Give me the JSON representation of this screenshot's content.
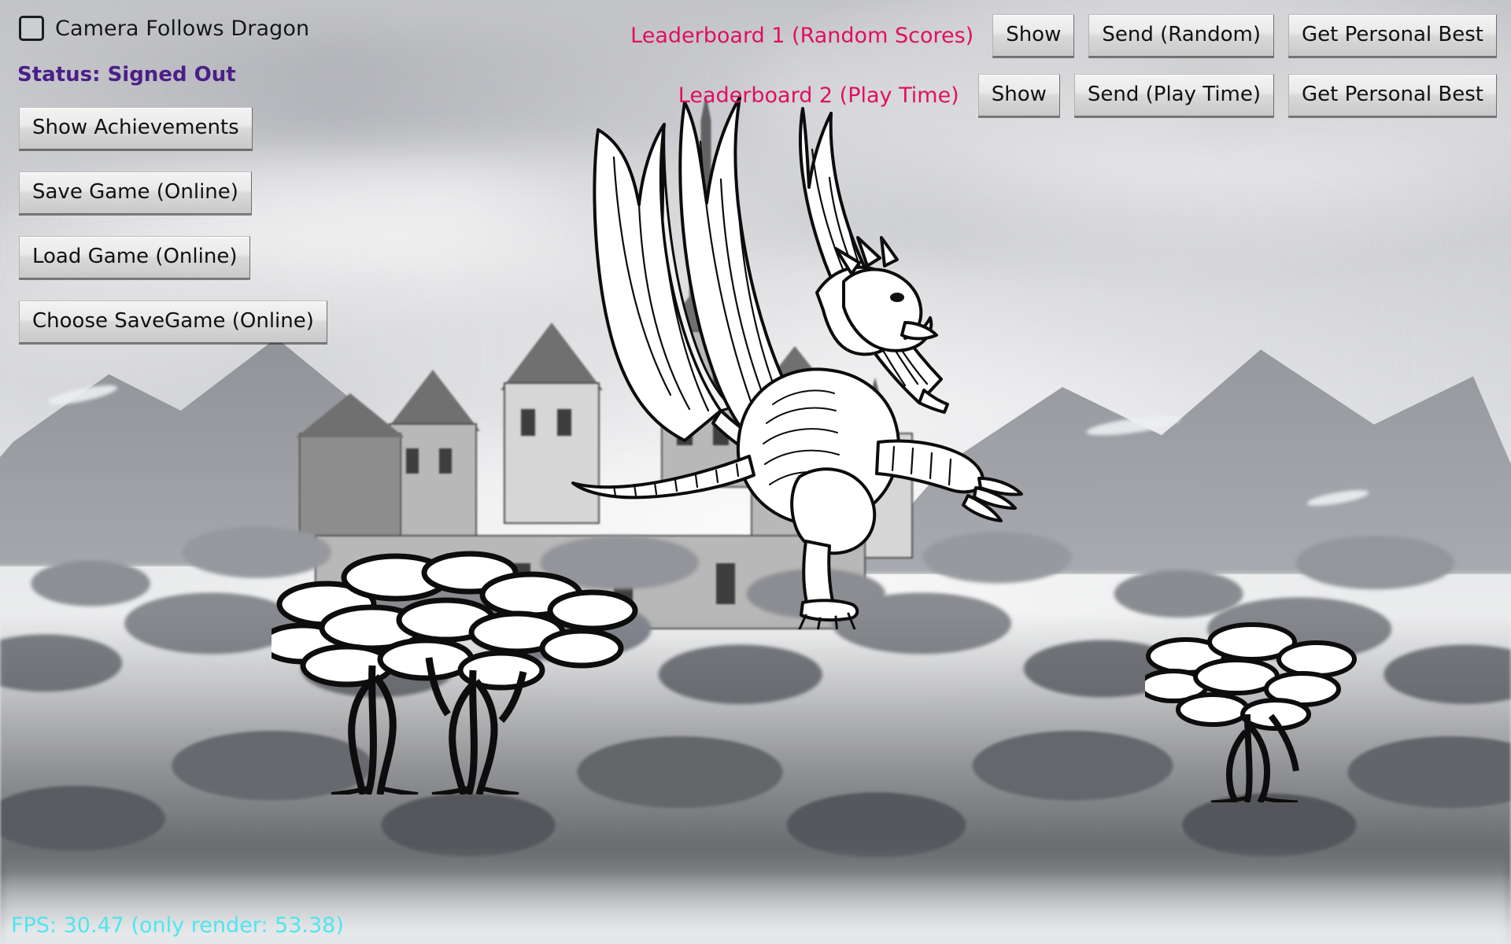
{
  "hud": {
    "camera_checkbox": {
      "label": "Camera Follows Dragon",
      "checked": false,
      "icon": "checkbox-unchecked-icon"
    },
    "status": {
      "text": "Status: Signed Out",
      "color": "#4a1f87"
    },
    "left_buttons": [
      {
        "label": "Show Achievements",
        "name": "show-achievements-button"
      },
      {
        "label": "Save Game (Online)",
        "name": "save-game-online-button"
      },
      {
        "label": "Load Game (Online)",
        "name": "load-game-online-button"
      },
      {
        "label": "Choose SaveGame (Online)",
        "name": "choose-savegame-online-button"
      }
    ],
    "leaderboards": {
      "title_color": "#e0105f",
      "rows": [
        {
          "title": "Leaderboard 1 (Random Scores)",
          "show_label": "Show",
          "send_label": "Send (Random)",
          "personal_best_label": "Get Personal Best"
        },
        {
          "title": "Leaderboard 2 (Play Time)",
          "show_label": "Show",
          "send_label": "Send (Play Time)",
          "personal_best_label": "Get Personal Best"
        }
      ]
    },
    "fps": {
      "text": "FPS: 30.47 (only render: 53.38)",
      "color": "#4fe6ee"
    }
  },
  "scene": {
    "description": "Grayscale ink-style fantasy landscape",
    "sky_color": "#dcdde0",
    "mountain_color": "#9c9ea4",
    "castle_color": "#b6b8bc",
    "dragon": {
      "name": "flying-dragon-sprite",
      "fill": "#ffffff",
      "stroke": "#0c0c0c"
    },
    "foreground_trees": [
      {
        "name": "foreground-tree-left"
      },
      {
        "name": "foreground-tree-right"
      }
    ]
  }
}
